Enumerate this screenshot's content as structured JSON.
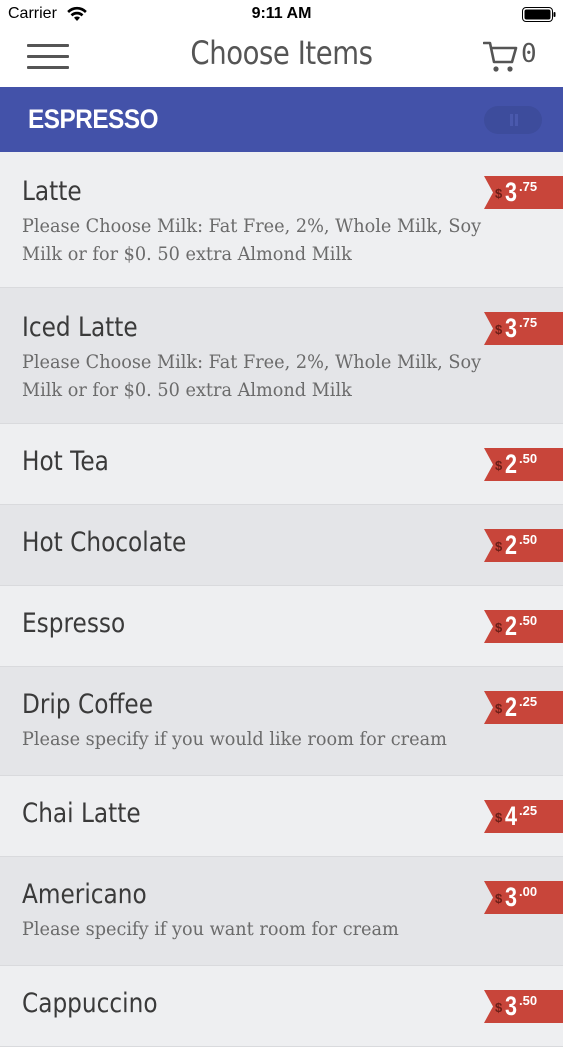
{
  "status_bar": {
    "carrier": "Carrier",
    "time": "9:11 AM"
  },
  "nav": {
    "title": "Choose Items",
    "cart_count": "0"
  },
  "category": {
    "title": "ESPRESSO"
  },
  "colors": {
    "header_blue": "#4352a9",
    "price_red": "#c8453a"
  },
  "items": [
    {
      "name": "Latte",
      "desc": "Please Choose Milk: Fat Free, 2%, Whole Milk, Soy Milk or for $0. 50 extra Almond Milk",
      "currency": "$",
      "price_whole": "3",
      "price_cents": ".75"
    },
    {
      "name": "Iced Latte",
      "desc": "Please Choose Milk: Fat Free, 2%, Whole Milk, Soy Milk or for $0. 50 extra Almond Milk",
      "currency": "$",
      "price_whole": "3",
      "price_cents": ".75"
    },
    {
      "name": "Hot Tea",
      "desc": "",
      "currency": "$",
      "price_whole": "2",
      "price_cents": ".50"
    },
    {
      "name": "Hot Chocolate",
      "desc": "",
      "currency": "$",
      "price_whole": "2",
      "price_cents": ".50"
    },
    {
      "name": "Espresso",
      "desc": "",
      "currency": "$",
      "price_whole": "2",
      "price_cents": ".50"
    },
    {
      "name": "Drip Coffee",
      "desc": "Please specify if you would like room for cream",
      "currency": "$",
      "price_whole": "2",
      "price_cents": ".25"
    },
    {
      "name": "Chai Latte",
      "desc": "",
      "currency": "$",
      "price_whole": "4",
      "price_cents": ".25"
    },
    {
      "name": "Americano",
      "desc": "Please specify if you want room for cream",
      "currency": "$",
      "price_whole": "3",
      "price_cents": ".00"
    },
    {
      "name": "Cappuccino",
      "desc": "",
      "currency": "$",
      "price_whole": "3",
      "price_cents": ".50"
    }
  ]
}
